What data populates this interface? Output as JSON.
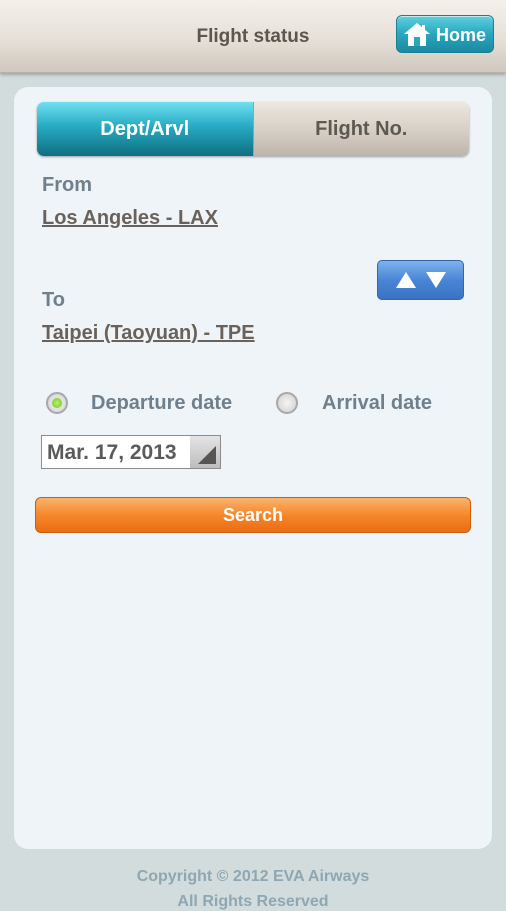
{
  "header": {
    "title": "Flight status",
    "home_label": "Home"
  },
  "tabs": [
    {
      "label": "Dept/Arvl",
      "active": true
    },
    {
      "label": "Flight No.",
      "active": false
    }
  ],
  "form": {
    "from_label": "From",
    "from_value": "Los Angeles - LAX",
    "to_label": "To",
    "to_value": "Taipei (Taoyuan) - TPE",
    "date_options": [
      {
        "label": "Departure date",
        "selected": true
      },
      {
        "label": "Arrival date",
        "selected": false
      }
    ],
    "date_value": "Mar. 17, 2013",
    "search_label": "Search"
  },
  "footer": {
    "copyright": "Copyright © 2012 EVA Airways",
    "rights": "All Rights Reserved"
  },
  "colors": {
    "accent_teal": "#27aac3",
    "search_orange": "#f6872b",
    "swap_blue": "#4a86d6"
  }
}
